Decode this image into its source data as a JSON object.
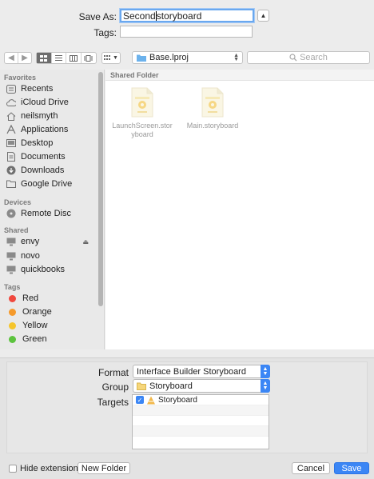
{
  "save_as": {
    "label": "Save As:",
    "value_before_caret": "Second",
    "value_after_caret": "storyboard"
  },
  "tags": {
    "label": "Tags:",
    "value": ""
  },
  "toolbar": {
    "location": "Base.lproj",
    "search_placeholder": "Search"
  },
  "sidebar": {
    "favorites_header": "Favorites",
    "favorites": [
      {
        "label": "Recents",
        "icon": "recents-icon"
      },
      {
        "label": "iCloud Drive",
        "icon": "cloud-icon"
      },
      {
        "label": "neilsmyth",
        "icon": "home-icon"
      },
      {
        "label": "Applications",
        "icon": "applications-icon"
      },
      {
        "label": "Desktop",
        "icon": "desktop-icon"
      },
      {
        "label": "Documents",
        "icon": "documents-icon"
      },
      {
        "label": "Downloads",
        "icon": "downloads-icon"
      },
      {
        "label": "Google Drive",
        "icon": "folder-icon"
      }
    ],
    "devices_header": "Devices",
    "devices": [
      {
        "label": "Remote Disc",
        "icon": "disc-icon"
      }
    ],
    "shared_header": "Shared",
    "shared": [
      {
        "label": "envy",
        "icon": "computer-icon"
      },
      {
        "label": "novo",
        "icon": "computer-icon"
      },
      {
        "label": "quickbooks",
        "icon": "computer-icon"
      }
    ],
    "tags_header": "Tags",
    "tags": [
      {
        "label": "Red",
        "color": "#f0483e"
      },
      {
        "label": "Orange",
        "color": "#f59a2c"
      },
      {
        "label": "Yellow",
        "color": "#f5c52c"
      },
      {
        "label": "Green",
        "color": "#5cc33e"
      }
    ]
  },
  "content": {
    "header": "Shared Folder",
    "files": [
      {
        "name_line1": "LaunchScreen.stor",
        "name_line2": "yboard"
      },
      {
        "name_line1": "Main.storyboard",
        "name_line2": ""
      }
    ]
  },
  "options": {
    "format_label": "Format",
    "format_value": "Interface Builder Storyboard",
    "group_label": "Group",
    "group_value": "Storyboard",
    "targets_label": "Targets",
    "targets": [
      {
        "label": "Storyboard",
        "checked": true
      }
    ]
  },
  "footer": {
    "hide_extension": "Hide extension",
    "new_folder": "New Folder",
    "cancel": "Cancel",
    "save": "Save"
  },
  "colors": {
    "accent": "#3b86f5",
    "sidebar_bg": "#e9e9e9",
    "window_bg": "#ececec"
  }
}
